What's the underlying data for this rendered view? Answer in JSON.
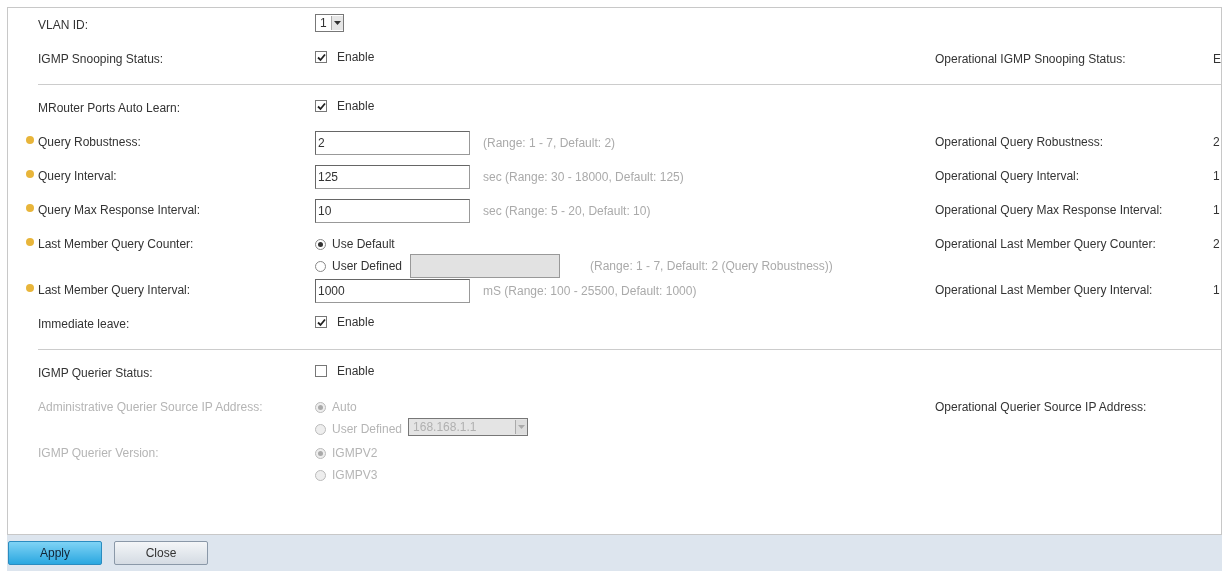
{
  "sections": [
    {
      "rows": [
        {
          "kind": "select",
          "label": "VLAN ID:",
          "required": false,
          "disabled": false,
          "value": "1"
        },
        {
          "kind": "checkbox",
          "label": "IGMP Snooping Status:",
          "required": false,
          "disabled": false,
          "checked": true,
          "option": "Enable",
          "operational": {
            "label": "Operational IGMP Snooping Status:",
            "value": "E"
          }
        }
      ]
    },
    {
      "rows": [
        {
          "kind": "checkbox",
          "label": "MRouter Ports Auto Learn:",
          "required": false,
          "disabled": false,
          "checked": true,
          "option": "Enable"
        },
        {
          "kind": "text",
          "label": "Query Robustness:",
          "required": true,
          "disabled": false,
          "value": "2",
          "hint": "(Range: 1 - 7, Default: 2)",
          "operational": {
            "label": "Operational Query Robustness:",
            "value": "2"
          }
        },
        {
          "kind": "text",
          "label": "Query Interval:",
          "required": true,
          "disabled": false,
          "value": "125",
          "hint": "sec (Range: 30 - 18000, Default: 125)",
          "operational": {
            "label": "Operational Query Interval:",
            "value": "1"
          }
        },
        {
          "kind": "text",
          "label": "Query Max Response Interval:",
          "required": true,
          "disabled": false,
          "value": "10",
          "hint": "sec (Range: 5 - 20, Default: 10)",
          "operational": {
            "label": "Operational Query Max Response Interval:",
            "value": "1"
          }
        },
        {
          "kind": "radio",
          "label": "Last Member Query Counter:",
          "required": true,
          "disabled": false,
          "options": [
            {
              "label": "Use Default",
              "selected": true
            },
            {
              "label": "User Defined",
              "selected": false,
              "field": {
                "kind": "text"
              },
              "hint": "(Range: 1 - 7, Default: 2 (Query Robustness))"
            }
          ],
          "operational": {
            "label": "Operational Last Member Query Counter:",
            "value": "2"
          }
        },
        {
          "kind": "text",
          "label": "Last Member Query Interval:",
          "required": true,
          "disabled": false,
          "value": "1000",
          "hint": "mS (Range: 100 - 25500, Default: 1000)",
          "operational": {
            "label": "Operational Last Member Query Interval:",
            "value": "1"
          }
        },
        {
          "kind": "checkbox",
          "label": "Immediate leave:",
          "required": false,
          "disabled": false,
          "checked": true,
          "option": "Enable"
        }
      ]
    },
    {
      "rows": [
        {
          "kind": "checkbox",
          "label": "IGMP Querier Status:",
          "required": false,
          "disabled": false,
          "checked": false,
          "option": "Enable"
        },
        {
          "kind": "radio",
          "label": "Administrative Querier Source IP Address:",
          "required": false,
          "disabled": true,
          "options": [
            {
              "label": "Auto",
              "selected": true
            },
            {
              "label": "User Defined",
              "selected": false,
              "field": {
                "kind": "select",
                "value": "168.168.1.1"
              }
            }
          ],
          "operational": {
            "label": "Operational Querier Source IP Address:"
          }
        },
        {
          "kind": "radio",
          "label": "IGMP Querier Version:",
          "required": false,
          "disabled": true,
          "options": [
            {
              "label": "IGMPV2",
              "selected": true
            },
            {
              "label": "IGMPV3",
              "selected": false
            }
          ]
        }
      ]
    }
  ],
  "buttons": [
    {
      "label": "Apply",
      "kind": "primary"
    },
    {
      "label": "Close",
      "kind": "secondary"
    }
  ]
}
